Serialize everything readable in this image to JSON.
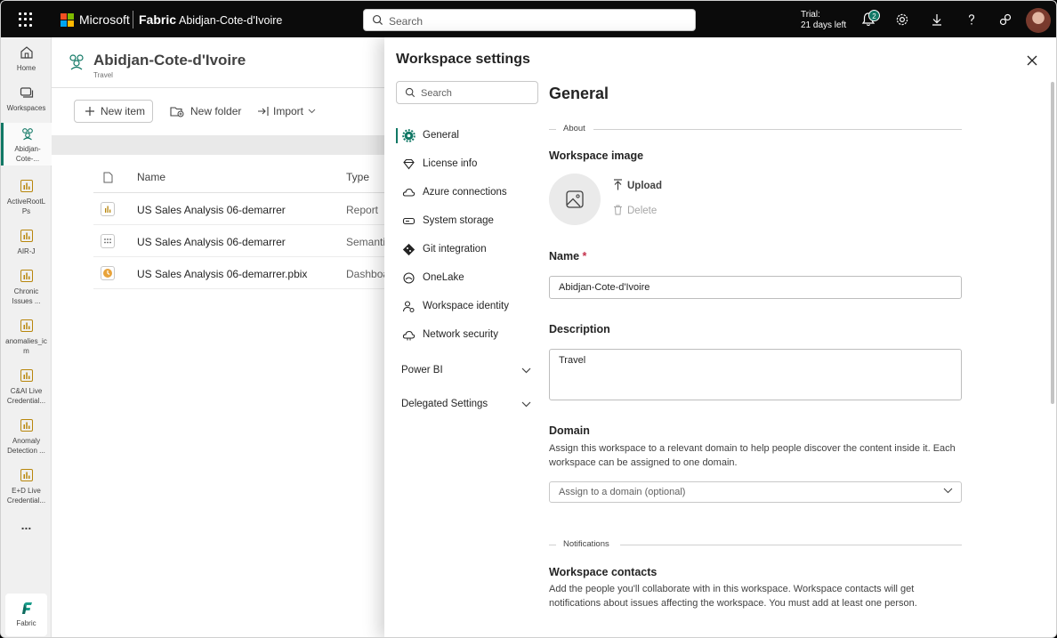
{
  "topbar": {
    "brand": "Microsoft",
    "product": "Fabric",
    "workspace": "Abidjan-Cote-d'Ivoire",
    "search_placeholder": "Search",
    "trial_line1": "Trial:",
    "trial_line2": "21 days left",
    "notification_count": "2"
  },
  "rail": {
    "items": [
      {
        "label": "Home",
        "icon": "home-icon"
      },
      {
        "label": "Workspaces",
        "icon": "workspaces-icon"
      },
      {
        "label": "Abidjan-Cote-...",
        "icon": "workspace-people-icon"
      },
      {
        "label": "ActiveRootLPs",
        "icon": "report-icon"
      },
      {
        "label": "AIR-J",
        "icon": "report-icon"
      },
      {
        "label": "Chronic Issues ...",
        "icon": "report-icon"
      },
      {
        "label": "anomalies_icm",
        "icon": "report-icon"
      },
      {
        "label": "C&AI Live Credential...",
        "icon": "report-icon"
      },
      {
        "label": "Anomaly Detection ...",
        "icon": "report-icon"
      },
      {
        "label": "E+D Live Credential...",
        "icon": "report-icon"
      }
    ],
    "more": "...",
    "bottom_label": "Fabric"
  },
  "workspace": {
    "title": "Abidjan-Cote-d'Ivoire",
    "subtitle": "Travel",
    "new_item": "New item",
    "new_folder": "New folder",
    "import": "Import",
    "col_name": "Name",
    "col_type": "Type",
    "rows": [
      {
        "name": "US Sales Analysis 06-demarrer",
        "type": "Report",
        "icon": "report-icon"
      },
      {
        "name": "US Sales Analysis 06-demarrer",
        "type": "Semantic model",
        "icon": "semantic-model-icon"
      },
      {
        "name": "US Sales Analysis 06-demarrer.pbix",
        "type": "Dashboard",
        "icon": "dashboard-icon"
      }
    ]
  },
  "settings": {
    "title": "Workspace settings",
    "search_placeholder": "Search",
    "nav": [
      {
        "label": "General",
        "icon": "gear-icon"
      },
      {
        "label": "License info",
        "icon": "diamond-icon"
      },
      {
        "label": "Azure connections",
        "icon": "cloud-icon"
      },
      {
        "label": "System storage",
        "icon": "storage-icon"
      },
      {
        "label": "Git integration",
        "icon": "git-icon"
      },
      {
        "label": "OneLake",
        "icon": "onelake-icon"
      },
      {
        "label": "Workspace identity",
        "icon": "identity-icon"
      },
      {
        "label": "Network security",
        "icon": "network-cloud-icon"
      }
    ],
    "groups": [
      "Power BI",
      "Delegated Settings"
    ],
    "general": {
      "title": "General",
      "about": "About",
      "image_label": "Workspace image",
      "upload": "Upload",
      "delete": "Delete",
      "name_label": "Name",
      "required_mark": "*",
      "name_value": "Abidjan-Cote-d'Ivoire",
      "description_label": "Description",
      "description_value": "Travel",
      "domain_label": "Domain",
      "domain_help": "Assign this workspace to a relevant domain to help people discover the content inside it. Each workspace can be assigned to one domain.",
      "domain_placeholder": "Assign to a domain (optional)",
      "notifications": "Notifications",
      "contacts_label": "Workspace contacts",
      "contacts_help": "Add the people you'll collaborate with in this workspace. Workspace contacts will get notifications about issues affecting the workspace. You must add at least one person."
    }
  },
  "colors": {
    "accent": "#117865",
    "topbar": "#0b0b0b"
  }
}
